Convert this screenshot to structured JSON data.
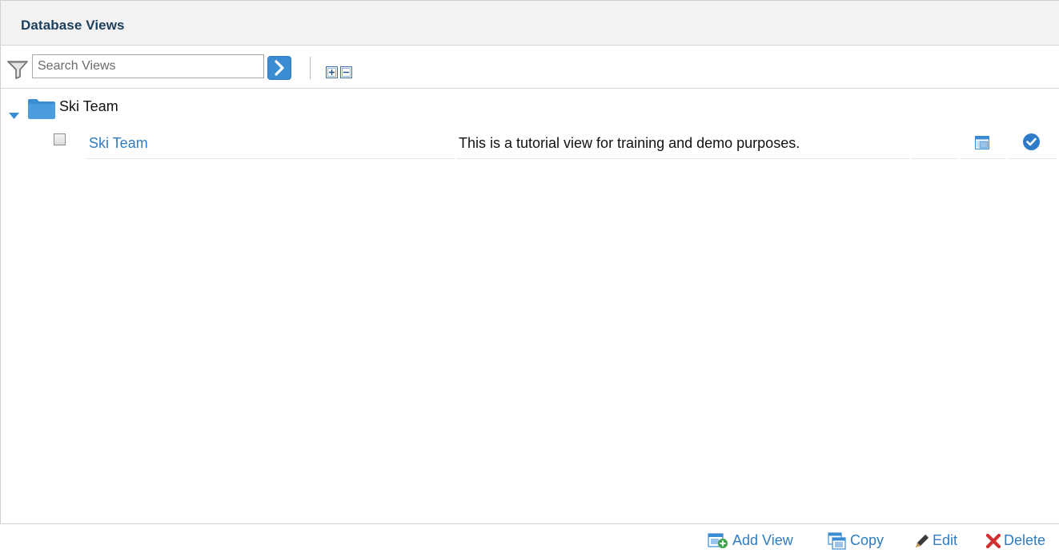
{
  "panel": {
    "title": "Database Views"
  },
  "toolbar": {
    "search_placeholder": "Search Views",
    "search_value": "",
    "icons": [
      "filter-icon",
      "go-arrow-icon",
      "expand-all-icon",
      "collapse-all-icon"
    ]
  },
  "tree": {
    "folders": [
      {
        "label": "Ski Team",
        "expanded": true,
        "icon": "folder-icon",
        "views": [
          {
            "name": "Ski Team",
            "description": "This is a tutorial view for training and demo purposes.",
            "checked": false,
            "icons": [
              "window-icon",
              "check-circle-icon"
            ]
          }
        ]
      }
    ]
  },
  "footer": {
    "add_view": "Add View",
    "copy": "Copy",
    "edit": "Edit",
    "delete": "Delete"
  },
  "colors": {
    "header_bg": "#f2f2f2",
    "title": "#1b3e5c",
    "link": "#2f7cc1",
    "accent_blue": "#3a8dd3",
    "delete_red": "#d32f2f"
  }
}
